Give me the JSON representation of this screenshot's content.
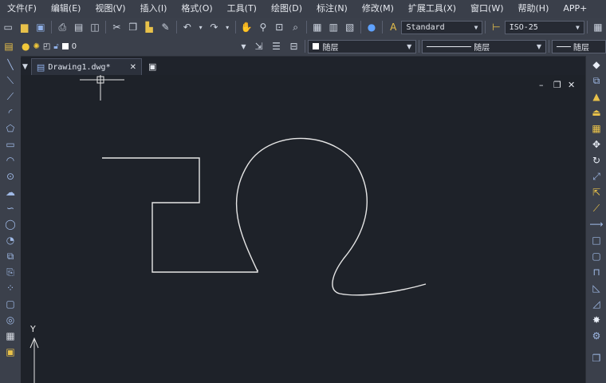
{
  "menu": [
    "文件(F)",
    "编辑(E)",
    "视图(V)",
    "插入(I)",
    "格式(O)",
    "工具(T)",
    "绘图(D)",
    "标注(N)",
    "修改(M)",
    "扩展工具(X)",
    "窗口(W)",
    "帮助(H)",
    "APP+"
  ],
  "toolbar": {
    "text_style": "Standard",
    "dim_style": "ISO-25",
    "layer_value": "0",
    "color_value": "随层",
    "linetype_value": "随层",
    "lineweight_value": "随层"
  },
  "tab": {
    "label": "Drawing1.dwg*",
    "close": "✕"
  },
  "canvas": {
    "y_axis_label": "Y"
  },
  "colors": {
    "background": "#1e2229",
    "toolbar": "#3b404b",
    "menubar": "#3a3f4a",
    "stroke": "#e6e6e6",
    "accent": "#9fb9e6"
  }
}
